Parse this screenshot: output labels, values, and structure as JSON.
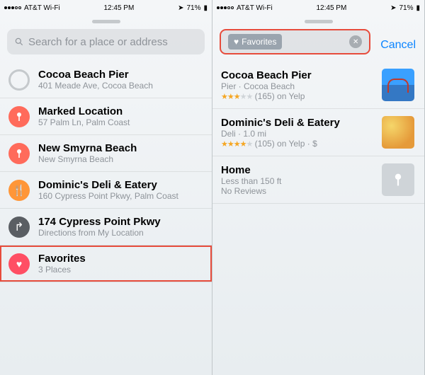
{
  "status": {
    "carrier": "AT&T Wi-Fi",
    "time": "12:45 PM",
    "battery": "71%"
  },
  "left": {
    "search_placeholder": "Search for a place or address",
    "rows": [
      {
        "title": "Cocoa Beach Pier",
        "sub": "401 Meade Ave, Cocoa Beach"
      },
      {
        "title": "Marked Location",
        "sub": "57 Palm Ln, Palm Coast"
      },
      {
        "title": "New Smyrna Beach",
        "sub": "New Smyrna Beach"
      },
      {
        "title": "Dominic's Deli & Eatery",
        "sub": "160 Cypress Point Pkwy, Palm Coast"
      },
      {
        "title": "174 Cypress Point Pkwy",
        "sub": "Directions from My Location"
      },
      {
        "title": "Favorites",
        "sub": "3 Places"
      }
    ]
  },
  "right": {
    "token": "Favorites",
    "cancel": "Cancel",
    "rows": [
      {
        "title": "Cocoa Beach Pier",
        "sub": "Pier · Cocoa Beach",
        "reviews": "(165) on Yelp"
      },
      {
        "title": "Dominic's Deli & Eatery",
        "sub": "Deli · 1.0 mi",
        "reviews": "(105) on Yelp · $"
      },
      {
        "title": "Home",
        "sub": "Less than 150 ft",
        "reviews": "No Reviews"
      }
    ]
  }
}
